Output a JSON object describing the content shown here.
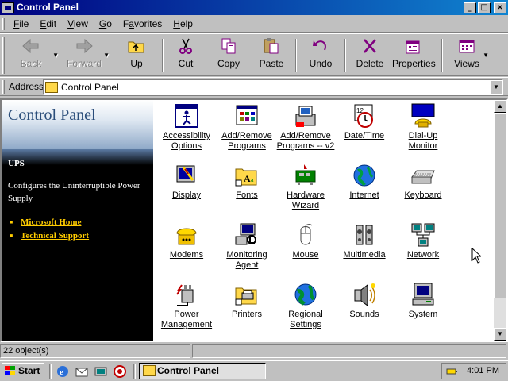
{
  "window": {
    "title": "Control Panel",
    "minimize": "_",
    "maximize": "□",
    "close": "×"
  },
  "menu": {
    "items": [
      {
        "key": "F",
        "rest": "ile"
      },
      {
        "key": "E",
        "rest": "dit"
      },
      {
        "key": "V",
        "rest": "iew"
      },
      {
        "key": "G",
        "rest": "o"
      },
      {
        "key": "F",
        "rest": "avorites",
        "pre": ""
      },
      {
        "key": "H",
        "rest": "elp"
      }
    ]
  },
  "toolbar": {
    "back": "Back",
    "forward": "Forward",
    "up": "Up",
    "cut": "Cut",
    "copy": "Copy",
    "paste": "Paste",
    "undo": "Undo",
    "delete": "Delete",
    "properties": "Properties",
    "views": "Views"
  },
  "address": {
    "label": "Address",
    "value": "Control Panel"
  },
  "left_pane": {
    "title": "Control Panel",
    "section": "UPS",
    "description": "Configures the Uninterruptible Power Supply",
    "links": [
      "Microsoft Home",
      "Technical Support"
    ]
  },
  "items": [
    {
      "label": "Accessibility\nOptions",
      "icon": "accessibility-icon"
    },
    {
      "label": "Add/Remove\nPrograms",
      "icon": "add-remove-programs-icon"
    },
    {
      "label": "Add/Remove\nPrograms -- v2",
      "icon": "add-remove-programs-v2-icon"
    },
    {
      "label": "Date/Time",
      "icon": "calendar-clock-icon"
    },
    {
      "label": "Dial-Up\nMonitor",
      "icon": "phone-monitor-icon"
    },
    {
      "label": "Display",
      "icon": "display-icon"
    },
    {
      "label": "Fonts",
      "icon": "fonts-folder-icon"
    },
    {
      "label": "Hardware\nWizard",
      "icon": "hardware-wizard-icon"
    },
    {
      "label": "Internet",
      "icon": "globe-icon"
    },
    {
      "label": "Keyboard",
      "icon": "keyboard-icon"
    },
    {
      "label": "Modems",
      "icon": "modem-icon"
    },
    {
      "label": "Monitoring\nAgent",
      "icon": "monitoring-agent-icon"
    },
    {
      "label": "Mouse",
      "icon": "mouse-icon"
    },
    {
      "label": "Multimedia",
      "icon": "multimedia-icon"
    },
    {
      "label": "Network",
      "icon": "network-icon"
    },
    {
      "label": "Power\nManagement",
      "icon": "power-plug-icon"
    },
    {
      "label": "Printers",
      "icon": "printers-folder-icon"
    },
    {
      "label": "Regional\nSettings",
      "icon": "regional-globe-icon"
    },
    {
      "label": "Sounds",
      "icon": "speaker-icon"
    },
    {
      "label": "System",
      "icon": "computer-icon"
    }
  ],
  "status": {
    "objects": "22 object(s)"
  },
  "taskbar": {
    "start": "Start",
    "task": "Control Panel",
    "clock": "4:01 PM"
  },
  "colors": {
    "title_start": "#000080",
    "title_end": "#1084d0",
    "link": "#ffcc00",
    "banner_title": "#2a4d7a"
  }
}
